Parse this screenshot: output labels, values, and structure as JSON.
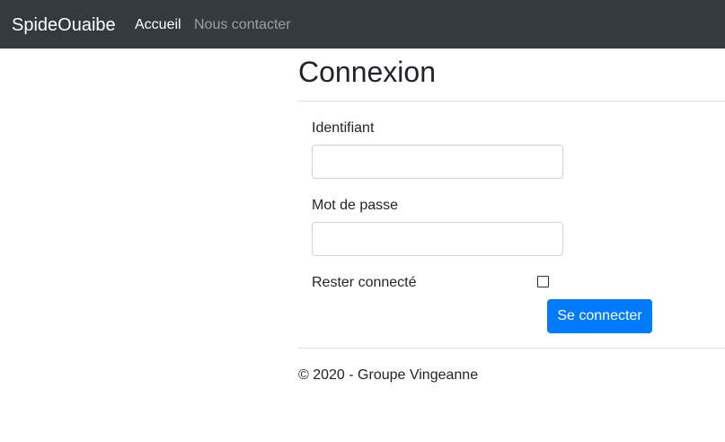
{
  "navbar": {
    "brand": "SpideOuaibe",
    "links": [
      {
        "label": "Accueil",
        "active": true
      },
      {
        "label": "Nous contacter",
        "active": false
      }
    ],
    "background_color": "#343a40"
  },
  "login": {
    "title": "Connexion",
    "username": {
      "label": "Identifiant",
      "value": ""
    },
    "password": {
      "label": "Mot de passe",
      "value": ""
    },
    "remember": {
      "label": "Rester connecté",
      "checked": false
    },
    "submit_label": "Se connecter",
    "accent_color": "#007bff"
  },
  "footer": {
    "text": "© 2020 - Groupe Vingeanne"
  }
}
